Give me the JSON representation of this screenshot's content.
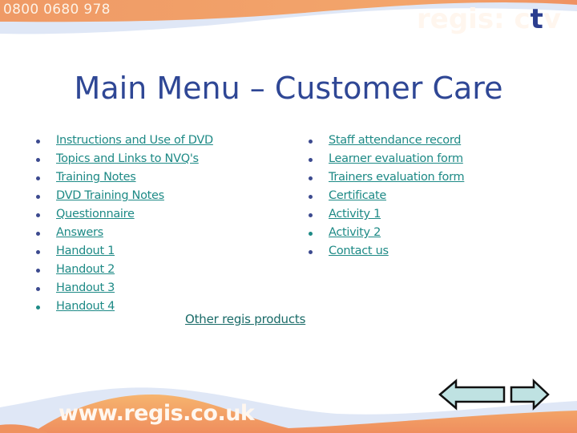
{
  "header": {
    "phone": "0800 0680 978",
    "logo_main": "regis: c",
    "logo_t": "t",
    "logo_end": "v"
  },
  "title": "Main Menu – Customer Care",
  "left_menu": [
    {
      "label": "Instructions and Use of DVD"
    },
    {
      "label": "Topics and Links to NVQ's"
    },
    {
      "label": "Training Notes"
    },
    {
      "label": "DVD Training Notes"
    },
    {
      "label": "Questionnaire"
    },
    {
      "label": "Answers"
    },
    {
      "label": "Handout 1"
    },
    {
      "label": "Handout 2"
    },
    {
      "label": "Handout 3"
    },
    {
      "label": "Handout 4"
    }
  ],
  "right_menu": [
    {
      "label": "Staff attendance record"
    },
    {
      "label": "Learner evaluation form"
    },
    {
      "label": "Trainers evaluation form"
    },
    {
      "label": "Certificate"
    },
    {
      "label": "Activity 1"
    },
    {
      "label": "Activity 2"
    },
    {
      "label": "Contact us"
    }
  ],
  "other_link": "Other regis products",
  "footer": {
    "website": "www.regis.co.uk"
  },
  "nav": {
    "prev_icon": "left-arrow-icon",
    "next_icon": "right-arrow-icon"
  },
  "colors": {
    "orange": "#f0955a",
    "light_blue": "#dfe7f6",
    "title_blue": "#2f4795",
    "link_teal": "#1e8a86",
    "arrow_fill": "#bfe2e2"
  }
}
